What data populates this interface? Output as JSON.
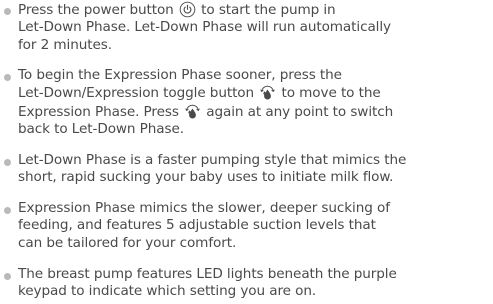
{
  "bullets": [
    {
      "lines": [
        [
          "Press the power button ",
          "",
          " to start the pump in"
        ],
        [
          "Let-Down Phase. Let-Down Phase will run automatically"
        ],
        [
          "for 2 minutes."
        ]
      ]
    },
    {
      "lines": [
        [
          "To begin the Expression Phase sooner, press the"
        ],
        [
          "Let-Down/Expression toggle button ",
          "",
          " to move to the"
        ],
        [
          "Expression Phase. Press ",
          "",
          " again at any point to switch"
        ],
        [
          "back to Let-Down Phase."
        ]
      ]
    },
    {
      "lines": [
        [
          "Let-Down Phase is a faster pumping style that mimics the"
        ],
        [
          "short, rapid sucking your baby uses to initiate milk flow."
        ]
      ]
    },
    {
      "lines": [
        [
          "Expression Phase mimics the slower, deeper sucking of"
        ],
        [
          "feeding, and features 5 adjustable suction levels that"
        ],
        [
          "can be tailored for your comfort."
        ]
      ]
    },
    {
      "lines": [
        [
          "The breast pump features LED lights beneath the purple"
        ],
        [
          "keypad to indicate which setting you are on."
        ]
      ]
    }
  ],
  "icons": {
    "power": "power-icon",
    "toggle": "droplets-toggle-icon"
  },
  "colors": {
    "text": "#4a4a4a",
    "bullet": "#b9b9b9"
  }
}
